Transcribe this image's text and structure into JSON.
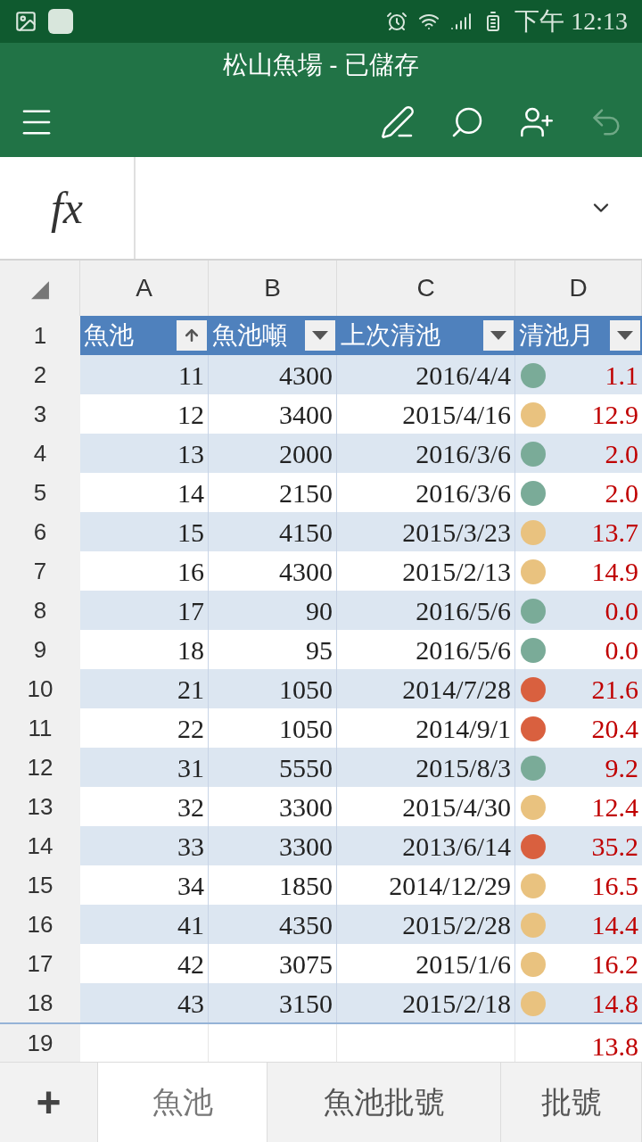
{
  "status_bar": {
    "time": "下午 12:13"
  },
  "app_bar": {
    "title": "松山魚場 - 已儲存"
  },
  "formula_bar": {
    "label": "fx"
  },
  "sheet": {
    "corner": "◢",
    "columns": [
      "A",
      "B",
      "C",
      "D"
    ],
    "header": {
      "row": "1",
      "cells": [
        {
          "text": "魚池",
          "kind": "sorted"
        },
        {
          "text": "魚池噸",
          "kind": "filter"
        },
        {
          "text": "上次清池",
          "kind": "filter"
        },
        {
          "text": "清池月",
          "kind": "filter"
        }
      ]
    },
    "rows": [
      {
        "row": "2",
        "a": "11",
        "b": "4300",
        "c": "2016/4/4",
        "color": "#7aab98",
        "d": "1.1"
      },
      {
        "row": "3",
        "a": "12",
        "b": "3400",
        "c": "2015/4/16",
        "color": "#e9c27f",
        "d": "12.9"
      },
      {
        "row": "4",
        "a": "13",
        "b": "2000",
        "c": "2016/3/6",
        "color": "#7aab98",
        "d": "2.0"
      },
      {
        "row": "5",
        "a": "14",
        "b": "2150",
        "c": "2016/3/6",
        "color": "#7aab98",
        "d": "2.0"
      },
      {
        "row": "6",
        "a": "15",
        "b": "4150",
        "c": "2015/3/23",
        "color": "#e9c27f",
        "d": "13.7"
      },
      {
        "row": "7",
        "a": "16",
        "b": "4300",
        "c": "2015/2/13",
        "color": "#e9c27f",
        "d": "14.9"
      },
      {
        "row": "8",
        "a": "17",
        "b": "90",
        "c": "2016/5/6",
        "color": "#7aab98",
        "d": "0.0"
      },
      {
        "row": "9",
        "a": "18",
        "b": "95",
        "c": "2016/5/6",
        "color": "#7aab98",
        "d": "0.0"
      },
      {
        "row": "10",
        "a": "21",
        "b": "1050",
        "c": "2014/7/28",
        "color": "#d9603f",
        "d": "21.6"
      },
      {
        "row": "11",
        "a": "22",
        "b": "1050",
        "c": "2014/9/1",
        "color": "#d9603f",
        "d": "20.4"
      },
      {
        "row": "12",
        "a": "31",
        "b": "5550",
        "c": "2015/8/3",
        "color": "#7aab98",
        "d": "9.2"
      },
      {
        "row": "13",
        "a": "32",
        "b": "3300",
        "c": "2015/4/30",
        "color": "#e9c27f",
        "d": "12.4"
      },
      {
        "row": "14",
        "a": "33",
        "b": "3300",
        "c": "2013/6/14",
        "color": "#d9603f",
        "d": "35.2"
      },
      {
        "row": "15",
        "a": "34",
        "b": "1850",
        "c": "2014/12/29",
        "color": "#e9c27f",
        "d": "16.5"
      },
      {
        "row": "16",
        "a": "41",
        "b": "4350",
        "c": "2015/2/28",
        "color": "#e9c27f",
        "d": "14.4"
      },
      {
        "row": "17",
        "a": "42",
        "b": "3075",
        "c": "2015/1/6",
        "color": "#e9c27f",
        "d": "16.2"
      },
      {
        "row": "18",
        "a": "43",
        "b": "3150",
        "c": "2015/2/18",
        "color": "#e9c27f",
        "d": "14.8"
      }
    ],
    "total": {
      "row": "19",
      "d": "13.8"
    }
  },
  "tabs": {
    "add": "+",
    "items": [
      {
        "label": "魚池",
        "selected": true
      },
      {
        "label": "魚池批號",
        "selected": false
      },
      {
        "label": "批號",
        "selected": false
      }
    ]
  }
}
